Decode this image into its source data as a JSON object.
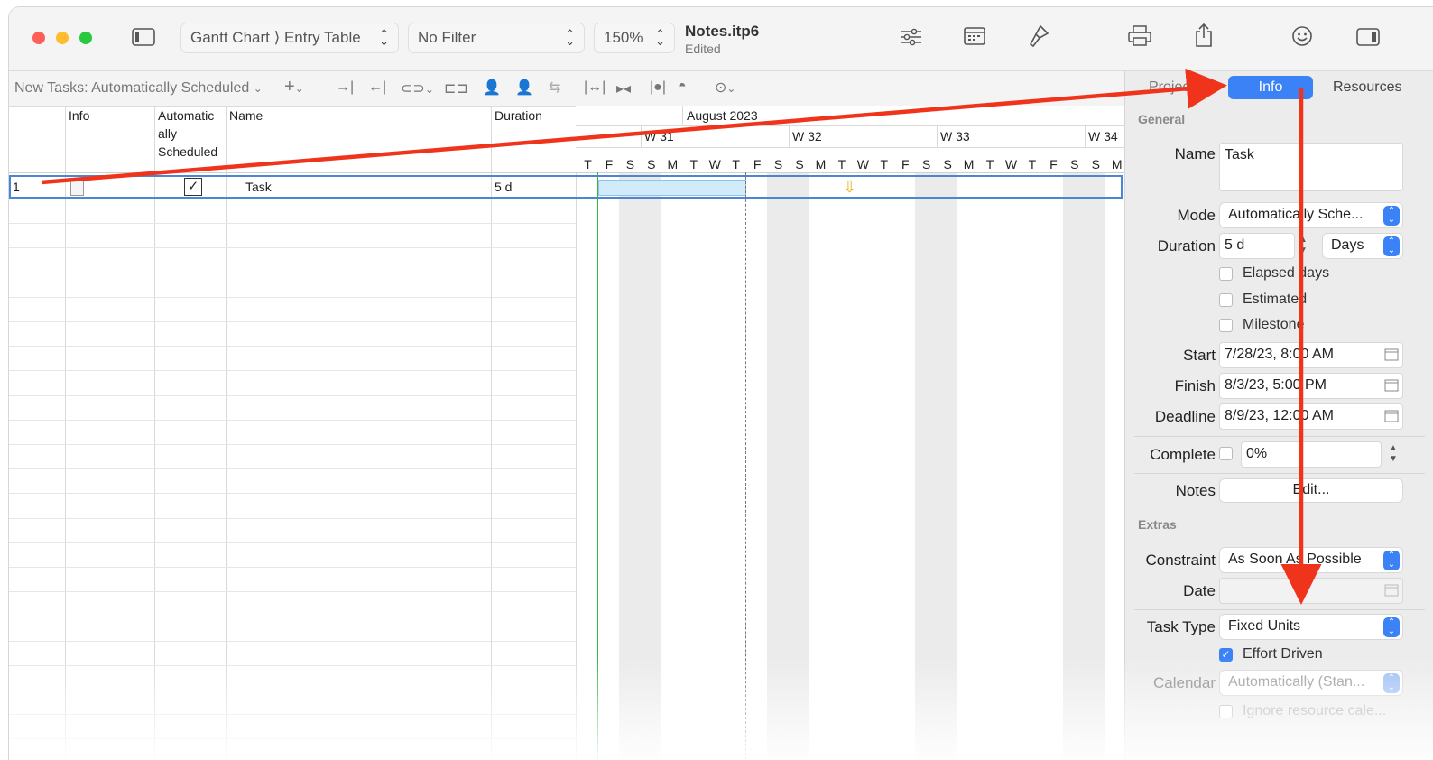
{
  "window": {
    "file_name": "Notes.itp6",
    "file_status": "Edited",
    "view_selector": "Gantt Chart ⟩ Entry Table",
    "filter_selector": "No Filter",
    "zoom": "150%"
  },
  "toolbar2": {
    "new_tasks_label": "New Tasks: Automatically Scheduled"
  },
  "table": {
    "headers": {
      "info": "Info",
      "auto_line1": "Automatic",
      "auto_line2": "ally",
      "auto_line3": "Scheduled",
      "name": "Name",
      "duration": "Duration"
    },
    "rows": [
      {
        "id": "1",
        "auto": "✓",
        "name": "Task",
        "duration": "5 d"
      }
    ]
  },
  "gantt": {
    "month": "August 2023",
    "weeks": [
      "W 31",
      "W 32",
      "W 33",
      "W 34"
    ],
    "days": [
      "T",
      "F",
      "S",
      "S",
      "M",
      "T",
      "W",
      "T",
      "F",
      "S",
      "S",
      "M",
      "T",
      "W",
      "T",
      "F",
      "S",
      "S",
      "M",
      "T",
      "W",
      "T",
      "F",
      "S",
      "S",
      "M"
    ]
  },
  "inspector": {
    "tabs": {
      "project": "Project",
      "info": "Info",
      "resources": "Resources"
    },
    "general_title": "General",
    "name_label": "Name",
    "name_value": "Task",
    "mode_label": "Mode",
    "mode_value": "Automatically Sche...",
    "duration_label": "Duration",
    "duration_value": "5 d",
    "duration_unit": "Days",
    "elapsed_days": "Elapsed days",
    "estimated": "Estimated",
    "milestone": "Milestone",
    "start_label": "Start",
    "start_value": "7/28/23, 8:00 AM",
    "finish_label": "Finish",
    "finish_value": "8/3/23, 5:00 PM",
    "deadline_label": "Deadline",
    "deadline_value": "8/9/23, 12:00 AM",
    "complete_label": "Complete",
    "complete_value": "0%",
    "notes_label": "Notes",
    "notes_button": "Edit...",
    "extras_title": "Extras",
    "constraint_label": "Constraint",
    "constraint_value": "As Soon As Possible",
    "date_label": "Date",
    "task_type_label": "Task Type",
    "task_type_value": "Fixed Units",
    "effort_driven": "Effort Driven",
    "calendar_label": "Calendar",
    "calendar_value": "Automatically (Stan...",
    "ignore_resource": "Ignore resource cale..."
  },
  "colors": {
    "accent": "#3a82f6",
    "arrow": "#f0341b"
  }
}
